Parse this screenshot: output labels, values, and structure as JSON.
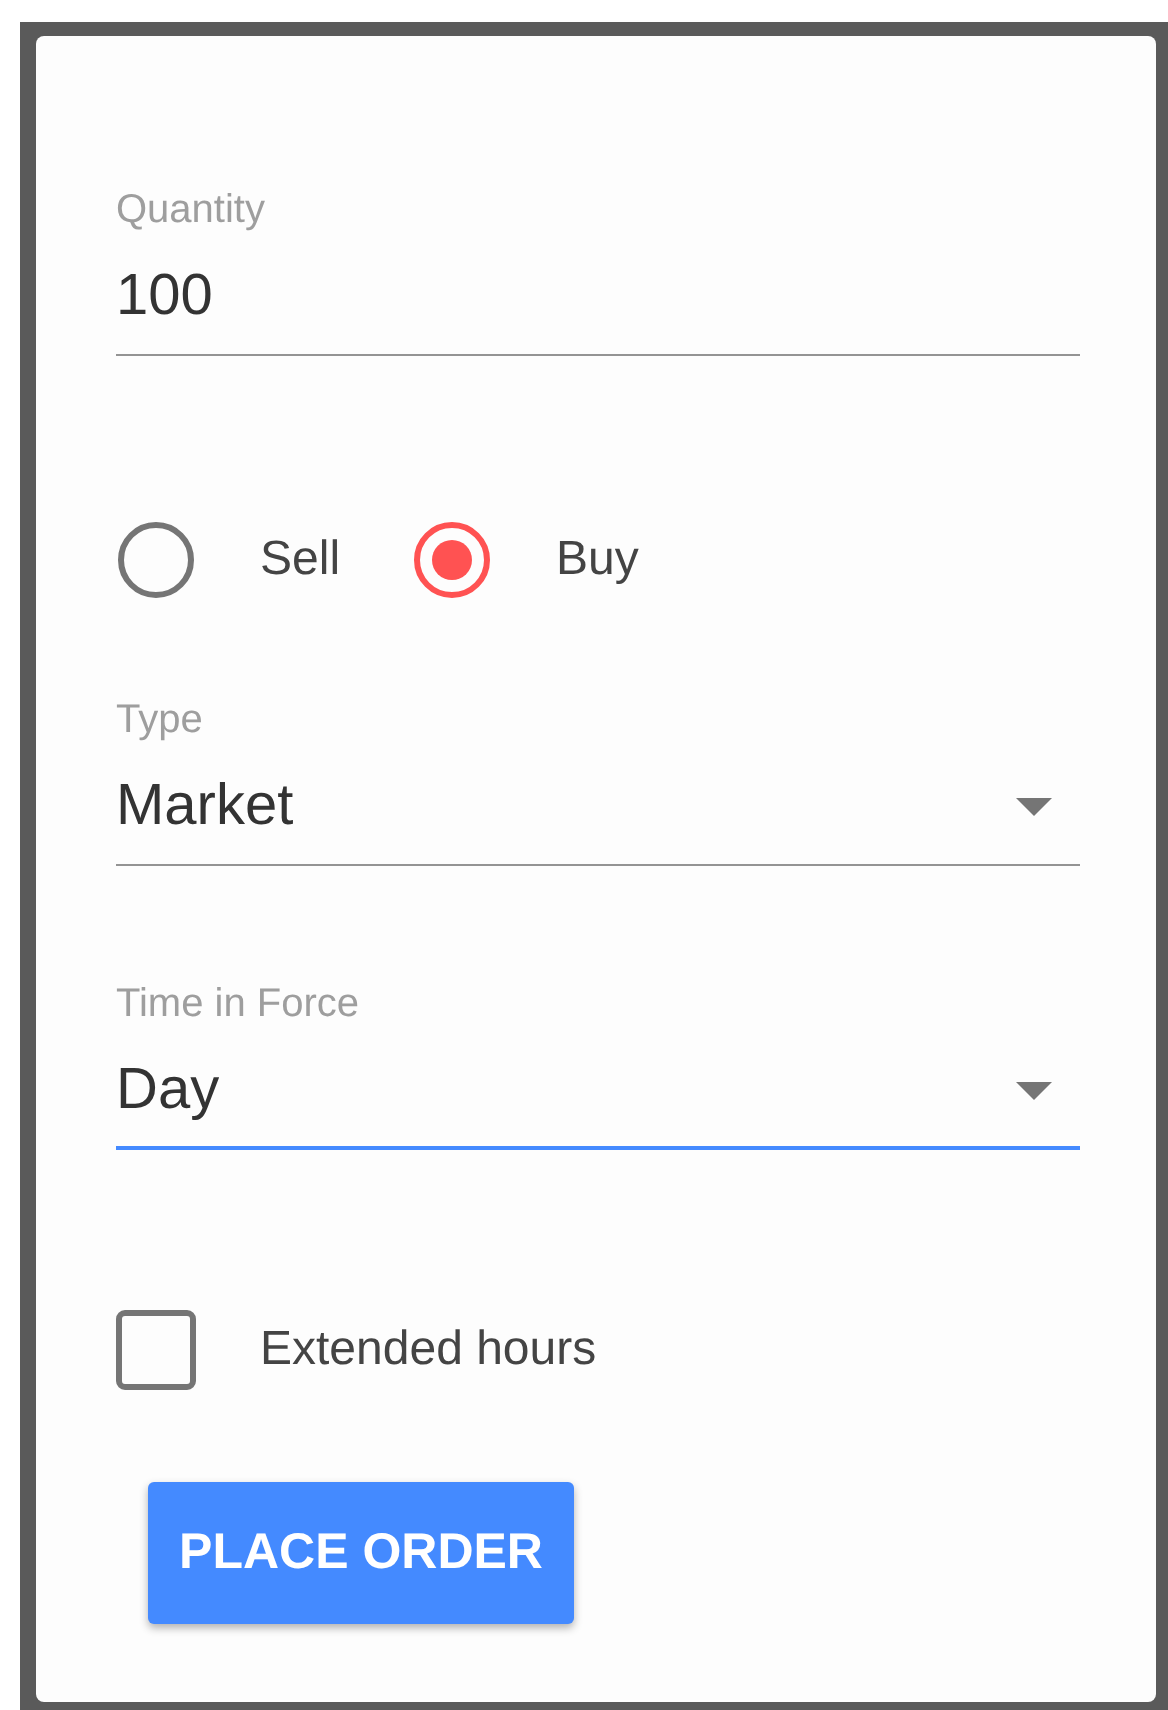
{
  "quantity": {
    "label": "Quantity",
    "value": "100",
    "focused": false
  },
  "side_options": [
    {
      "label": "Sell",
      "selected": false
    },
    {
      "label": "Buy",
      "selected": true
    }
  ],
  "selects": [
    {
      "label": "Type",
      "value": "Market",
      "focused": false
    },
    {
      "label": "Time in Force",
      "value": "Day",
      "focused": true
    }
  ],
  "extended_hours": {
    "label": "Extended hours",
    "checked": false
  },
  "submit_button": "PLACE ORDER"
}
